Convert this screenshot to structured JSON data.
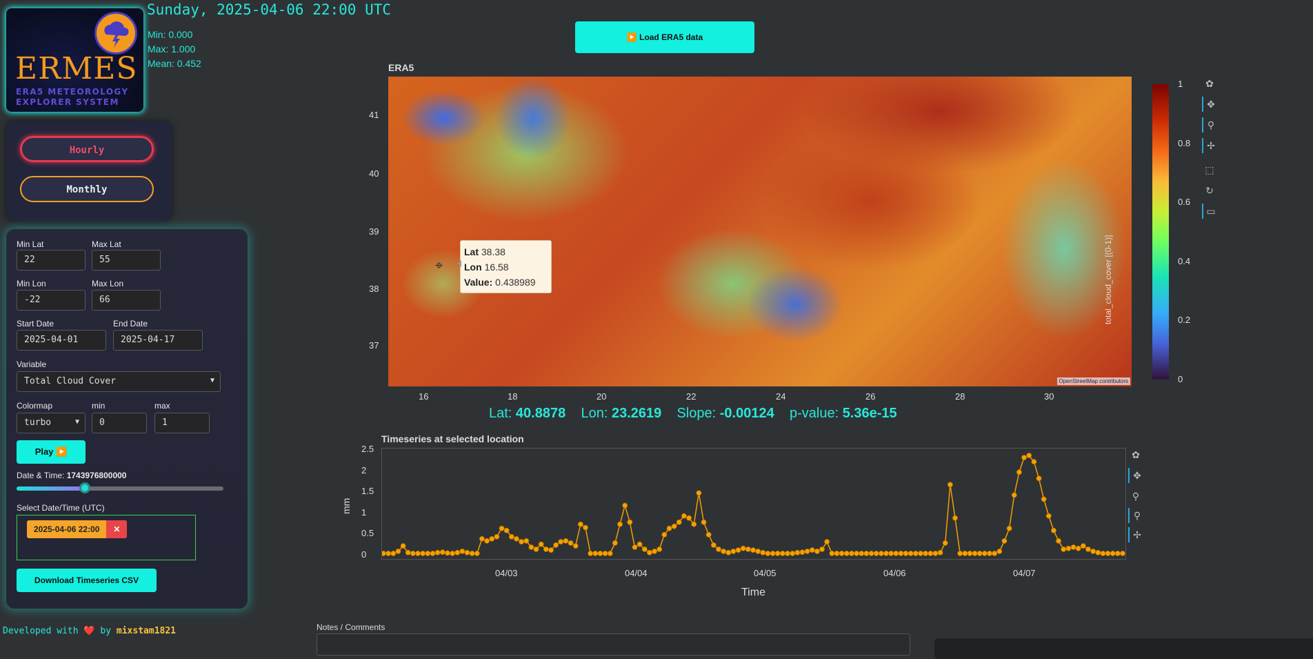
{
  "header": {
    "datetime_title": "Sunday, 2025-04-06 22:00 UTC",
    "stats": [
      "Min: 0.000",
      "Max: 1.000",
      "Mean: 0.452"
    ]
  },
  "logo": {
    "word": "ERMES",
    "sub_line1": "ERA5 METEOROLOGY",
    "sub_line2": "EXPLORER SYSTEM"
  },
  "mode": {
    "hourly": "Hourly",
    "monthly": "Monthly"
  },
  "controls": {
    "min_lat_label": "Min Lat",
    "min_lat": "22",
    "max_lat_label": "Max Lat",
    "max_lat": "55",
    "min_lon_label": "Min Lon",
    "min_lon": "-22",
    "max_lon_label": "Max Lon",
    "max_lon": "66",
    "start_date_label": "Start Date",
    "start_date": "2025-04-01",
    "end_date_label": "End Date",
    "end_date": "2025-04-17",
    "variable_label": "Variable",
    "variable": "Total Cloud Cover",
    "colormap_label": "Colormap",
    "colormap": "turbo",
    "min_label": "min",
    "min": "0",
    "max_label": "max",
    "max": "1",
    "play_label": "Play ▶️",
    "datetime_label": "Date & Time:",
    "datetime_value": "1743976800000",
    "slider_fraction": 0.35,
    "select_datetime_label": "Select Date/Time (UTC)",
    "selected_chip": "2025-04-06 22:00",
    "download_label": "Download Timeseries CSV"
  },
  "footer": {
    "prefix": "Developed with ❤️ by",
    "author": "mixstam1821"
  },
  "map": {
    "load_label": "▶️ Load ERA5 data",
    "title": "ERA5",
    "y_ticks": [
      "41",
      "40",
      "39",
      "38",
      "37"
    ],
    "x_ticks": [
      "16",
      "18",
      "20",
      "22",
      "24",
      "26",
      "28",
      "30"
    ],
    "osm_credit": "OpenStreetMap contributors",
    "tooltip": {
      "lat_label": "Lat",
      "lat": "38.38",
      "lon_label": "Lon",
      "lon": "16.58",
      "value_label": "Value:",
      "value": "0.438989"
    },
    "colorbar_ticks": [
      "1",
      "0.8",
      "0.6",
      "0.4",
      "0.2",
      "0"
    ],
    "colorbar_title": "total_cloud_cover [(0-1)]"
  },
  "stats_line": {
    "lat_label": "Lat:",
    "lat": "40.8878",
    "lon_label": "Lon:",
    "lon": "23.2619",
    "slope_label": "Slope:",
    "slope": "-0.00124",
    "pvalue_label": "p-value:",
    "pvalue": "5.36e-15"
  },
  "notes": {
    "label": "Notes / Comments"
  },
  "chart_data": {
    "type": "line",
    "title": "Timeseries at selected location",
    "xlabel": "Time",
    "ylabel": "mm",
    "ylim": [
      0,
      2.5
    ],
    "y_ticks": [
      "2.5",
      "2",
      "1.5",
      "1",
      "0.5",
      "0"
    ],
    "x_ticks": [
      "04/03",
      "04/04",
      "04/05",
      "04/06",
      "04/07"
    ],
    "line_color": "#f5a000",
    "values": [
      0,
      0,
      0,
      0.05,
      0.18,
      0.02,
      0,
      0,
      0,
      0,
      0,
      0.02,
      0.03,
      0.01,
      0,
      0.02,
      0.05,
      0.02,
      0,
      0,
      0.35,
      0.3,
      0.35,
      0.4,
      0.6,
      0.55,
      0.4,
      0.35,
      0.28,
      0.3,
      0.15,
      0.1,
      0.22,
      0.1,
      0.08,
      0.2,
      0.28,
      0.3,
      0.25,
      0.18,
      0.7,
      0.62,
      0,
      0,
      0,
      0,
      0,
      0.25,
      0.7,
      1.15,
      0.75,
      0.15,
      0.22,
      0.1,
      0.02,
      0.05,
      0.1,
      0.45,
      0.6,
      0.65,
      0.75,
      0.9,
      0.85,
      0.7,
      1.45,
      0.75,
      0.45,
      0.2,
      0.1,
      0.05,
      0.02,
      0.05,
      0.08,
      0.12,
      0.1,
      0.08,
      0.05,
      0.02,
      0,
      0,
      0,
      0,
      0,
      0,
      0.02,
      0.03,
      0.05,
      0.08,
      0.05,
      0.1,
      0.28,
      0,
      0,
      0,
      0,
      0,
      0,
      0,
      0,
      0,
      0,
      0,
      0,
      0,
      0,
      0,
      0,
      0,
      0,
      0,
      0,
      0,
      0,
      0.02,
      0.25,
      1.65,
      0.85,
      0,
      0,
      0,
      0,
      0,
      0,
      0,
      0,
      0.05,
      0.3,
      0.6,
      1.4,
      1.95,
      2.3,
      2.35,
      2.2,
      1.8,
      1.3,
      0.9,
      0.55,
      0.3,
      0.1,
      0.12,
      0.15,
      0.12,
      0.18,
      0.1,
      0.05,
      0.02,
      0,
      0,
      0,
      0,
      0
    ]
  }
}
